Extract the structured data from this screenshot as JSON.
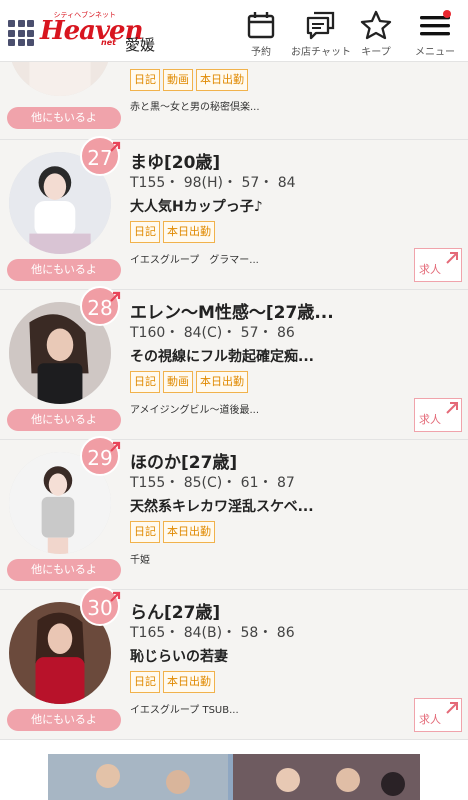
{
  "header": {
    "area": "愛媛",
    "logo_small": "シティヘブンネット",
    "logo_main": "Heaven",
    "logo_net": "net",
    "reserve_label": "予約",
    "chat_label": "お店チャット",
    "keep_label": "キープ",
    "menu_label": "メニュー"
  },
  "colors": {
    "accent": "#d8151f",
    "rank_pink": "#f09da4",
    "tag_orange": "#e08a00"
  },
  "first_card": {
    "tags": [
      "日記",
      "動画",
      "本日出勤"
    ],
    "shop": "赤と黒〜女と男の秘密倶楽...",
    "others": "他にもいるよ"
  },
  "cards": [
    {
      "rank": "27",
      "name": "まゆ[20歳]",
      "stats": "T155・ 98(H)・ 57・ 84",
      "catch": "大人気Hカップっ子♪",
      "tags": [
        "日記",
        "本日出勤"
      ],
      "shop": "イエスグループ　グラマー...",
      "others": "他にもいるよ",
      "job": "求人"
    },
    {
      "rank": "28",
      "name": "エレン〜M性感〜[27歳...",
      "stats": "T160・ 84(C)・ 57・ 86",
      "catch": "その視線にフル勃起確定痴...",
      "tags": [
        "日記",
        "動画",
        "本日出勤"
      ],
      "shop": "アメイジングビル〜道後最...",
      "others": "他にもいるよ",
      "job": "求人"
    },
    {
      "rank": "29",
      "name": "ほのか[27歳]",
      "stats": "T155・ 85(C)・ 61・ 87",
      "catch": "天然系キレカワ淫乱スケベ...",
      "tags": [
        "日記",
        "本日出勤"
      ],
      "shop": "千姫",
      "others": "他にもいるよ",
      "job": null
    },
    {
      "rank": "30",
      "name": "らん[27歳]",
      "stats": "T165・ 84(B)・ 58・ 86",
      "catch": "恥じらいの若妻",
      "tags": [
        "日記",
        "本日出勤"
      ],
      "shop": "イエスグループ TSUB...",
      "others": "他にもいるよ",
      "job": "求人"
    }
  ]
}
